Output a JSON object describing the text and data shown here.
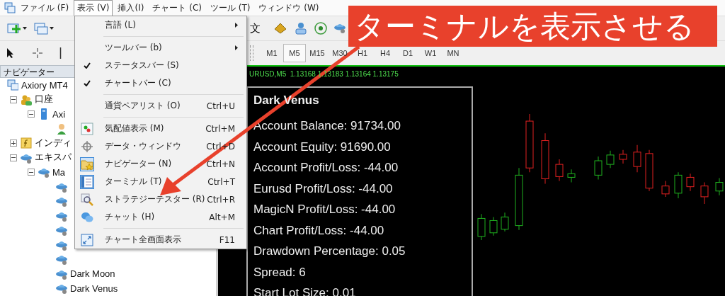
{
  "menu_bar": {
    "items": [
      {
        "label": "ファイル (F)",
        "selected": false
      },
      {
        "label": "表示 (V)",
        "selected": true
      },
      {
        "label": "挿入(I)",
        "selected": false
      },
      {
        "label": "チャート (C)",
        "selected": false
      },
      {
        "label": "ツール (T)",
        "selected": false
      },
      {
        "label": "ウィンドウ (W)",
        "selected": false
      }
    ]
  },
  "toolbar": {
    "button_label": "文"
  },
  "timeframes": [
    {
      "label": "M1",
      "selected": false
    },
    {
      "label": "M5",
      "selected": true
    },
    {
      "label": "M15",
      "selected": false
    },
    {
      "label": "M30",
      "selected": false
    },
    {
      "label": "H1",
      "selected": false
    },
    {
      "label": "H4",
      "selected": false
    },
    {
      "label": "D1",
      "selected": false
    },
    {
      "label": "W1",
      "selected": false
    },
    {
      "label": "MN",
      "selected": false
    }
  ],
  "navigator": {
    "title": "ナビゲーター",
    "tree": [
      {
        "kind": "terminal",
        "label": "Axiory MT4",
        "children": [
          {
            "kind": "accounts",
            "label": "口座",
            "expanded": true,
            "children": [
              {
                "kind": "server",
                "label": "Axi",
                "expanded": true,
                "children": [
                  {
                    "kind": "user"
                  }
                ]
              }
            ]
          },
          {
            "kind": "indicators",
            "label": "インディ",
            "expanded": false
          },
          {
            "kind": "experts",
            "label": "エキスパ",
            "expanded": true,
            "children": [
              {
                "kind": "folder",
                "label": "Ma",
                "expanded": true,
                "children": [
                  {
                    "kind": "expert"
                  },
                  {
                    "kind": "expert"
                  },
                  {
                    "kind": "expert"
                  },
                  {
                    "kind": "expert"
                  },
                  {
                    "kind": "expert"
                  },
                  {
                    "kind": "expert"
                  },
                  {
                    "kind": "expert",
                    "label": "Dark Moon"
                  },
                  {
                    "kind": "expert",
                    "label": "Dark Venus"
                  }
                ]
              }
            ]
          }
        ]
      }
    ]
  },
  "view_menu": {
    "items": [
      {
        "kind": "submenu",
        "label": "言語 (L)"
      },
      {
        "kind": "separator"
      },
      {
        "kind": "submenu",
        "label": "ツールバー (b)"
      },
      {
        "kind": "check",
        "label": "ステータスバー (S)",
        "checked": true
      },
      {
        "kind": "check",
        "label": "チャートバー (C)",
        "checked": true
      },
      {
        "kind": "separator"
      },
      {
        "kind": "plain",
        "label": "通貨ペアリスト (O)",
        "shortcut": "Ctrl+U"
      },
      {
        "kind": "separator"
      },
      {
        "kind": "market-watch",
        "label": "気配値表示 (M)",
        "shortcut": "Ctrl+M",
        "active": false
      },
      {
        "kind": "data-window",
        "label": "データ・ウィンドウ",
        "shortcut": "Ctrl+D",
        "active": false
      },
      {
        "kind": "navigator",
        "label": "ナビゲーター (N)",
        "shortcut": "Ctrl+N",
        "active": true
      },
      {
        "kind": "terminal",
        "label": "ターミナル (T)",
        "shortcut": "Ctrl+T",
        "active": true
      },
      {
        "kind": "tester",
        "label": "ストラテジーテスター (R)",
        "shortcut": "Ctrl+R",
        "active": false
      },
      {
        "kind": "chat",
        "label": "チャット (H)",
        "shortcut": "Alt+M",
        "active": false
      },
      {
        "kind": "separator"
      },
      {
        "kind": "fullscreen",
        "label": "チャート全画面表示",
        "shortcut": "F11",
        "active": false
      }
    ]
  },
  "chart": {
    "header": "URUSD,M5  1.13168 1.13183 1.13164 1.13175",
    "panel": {
      "title": "Dark Venus",
      "lines": [
        "Account Balance: 91734.00",
        "Account Equity: 91690.00",
        "Account Profit/Loss: -44.00",
        "Eurusd Profit/Loss: -44.00",
        "MagicN Profit/Loss: -44.00",
        "Chart Profit/Loss: -44.00",
        "Drawdown Percentage: 0.05",
        "Spread: 6",
        "Start Lot Size: 0.01"
      ]
    }
  },
  "callout": {
    "text": "ターミナルを表示させる"
  }
}
